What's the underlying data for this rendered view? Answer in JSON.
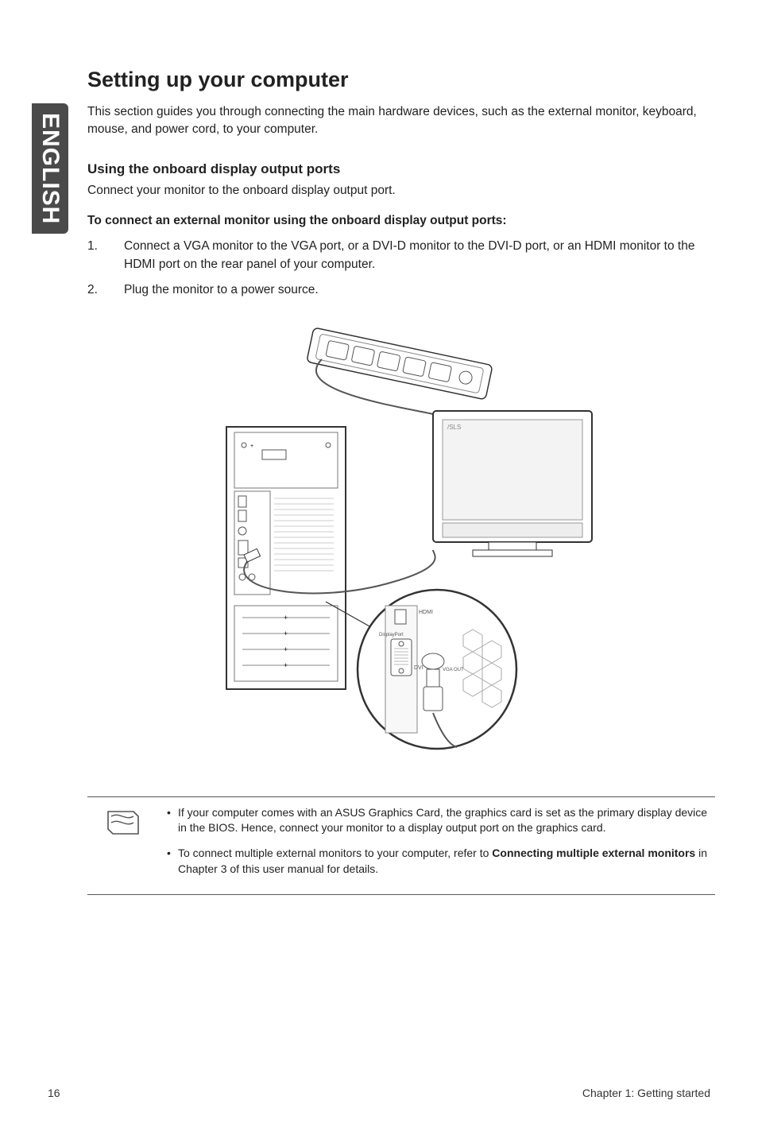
{
  "sidebar": {
    "language": "ENGLISH"
  },
  "section": {
    "title": "Setting up your computer",
    "intro": "This section guides you through connecting the main hardware devices, such as the external monitor, keyboard, mouse, and power cord, to your computer."
  },
  "subsection": {
    "title": "Using the onboard display output ports",
    "text": "Connect your monitor to the onboard display output port.",
    "instruction_heading": "To connect an external monitor using the onboard display output ports:",
    "steps": [
      {
        "num": "1.",
        "text": "Connect a VGA monitor to the VGA port, or a DVI-D monitor to the DVI-D port, or an HDMI monitor to the HDMI port on the rear panel of your computer."
      },
      {
        "num": "2.",
        "text": "Plug the monitor to a power source."
      }
    ]
  },
  "diagram": {
    "port_labels": {
      "hdmi": "HDMI",
      "displayport": "DisplayPort",
      "dvi": "DVI",
      "vga": "VGA OUT"
    }
  },
  "notes": {
    "items": [
      {
        "pre": "If your computer comes with an ASUS Graphics Card, the graphics card is set as the primary display device in the BIOS. Hence, connect your monitor to a display output port on the graphics card.",
        "bold": "",
        "post": ""
      },
      {
        "pre": "To connect multiple external monitors to your computer, refer to ",
        "bold": "Connecting multiple external monitors",
        "post": " in Chapter 3 of this user manual for details."
      }
    ]
  },
  "footer": {
    "page": "16",
    "chapter": "Chapter 1: Getting started"
  }
}
